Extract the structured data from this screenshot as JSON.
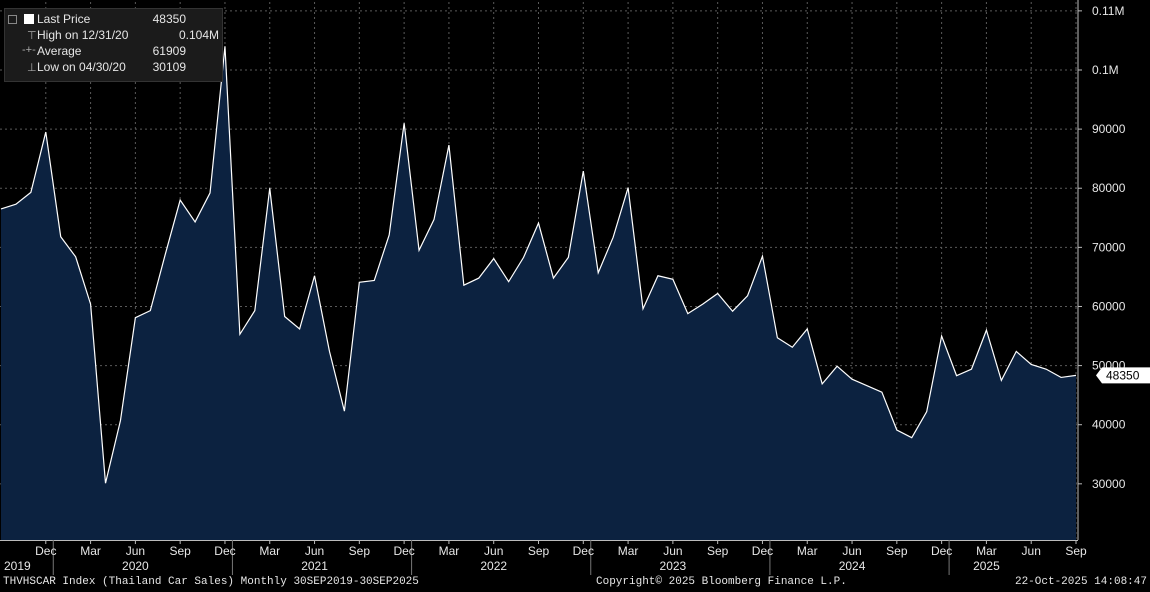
{
  "legend": {
    "last_price_label": "Last Price",
    "last_price_value": "48350",
    "high_label": "High on 12/31/20",
    "high_value": "0.104M",
    "average_label": "Average",
    "average_value": "61909",
    "low_label": "Low on 04/30/20",
    "low_value": "30109"
  },
  "footer": {
    "left": "THVHSCAR Index (Thailand Car Sales) Monthly 30SEP2019-30SEP2025",
    "center": "Copyright© 2025 Bloomberg Finance L.P.",
    "right": "22-Oct-2025 14:08:47"
  },
  "colors": {
    "background": "#000000",
    "area_fill": "#0c2240",
    "line": "#ffffff",
    "grid": "#5a5a5a",
    "text": "#e6e6e6"
  },
  "chart_data": {
    "type": "area",
    "title": "THVHSCAR Index (Thailand Car Sales)",
    "x_start": "2019-09",
    "x_end": "2025-09",
    "x_freq": "monthly",
    "y_ticks": [
      {
        "value": 30000,
        "label": "30000"
      },
      {
        "value": 40000,
        "label": "40000"
      },
      {
        "value": 50000,
        "label": "50000"
      },
      {
        "value": 60000,
        "label": "60000"
      },
      {
        "value": 70000,
        "label": "70000"
      },
      {
        "value": 80000,
        "label": "80000"
      },
      {
        "value": 90000,
        "label": "90000"
      },
      {
        "value": 100000,
        "label": "0.1M"
      },
      {
        "value": 110000,
        "label": "0.11M"
      }
    ],
    "ylim": [
      20500,
      111500
    ],
    "last_value_label": "48350",
    "x_month_ticks": [
      {
        "date": "2019-12",
        "label": "Dec"
      },
      {
        "date": "2020-03",
        "label": "Mar"
      },
      {
        "date": "2020-06",
        "label": "Jun"
      },
      {
        "date": "2020-09",
        "label": "Sep"
      },
      {
        "date": "2020-12",
        "label": "Dec"
      },
      {
        "date": "2021-03",
        "label": "Mar"
      },
      {
        "date": "2021-06",
        "label": "Jun"
      },
      {
        "date": "2021-09",
        "label": "Sep"
      },
      {
        "date": "2021-12",
        "label": "Dec"
      },
      {
        "date": "2022-03",
        "label": "Mar"
      },
      {
        "date": "2022-06",
        "label": "Jun"
      },
      {
        "date": "2022-09",
        "label": "Sep"
      },
      {
        "date": "2022-12",
        "label": "Dec"
      },
      {
        "date": "2023-03",
        "label": "Mar"
      },
      {
        "date": "2023-06",
        "label": "Jun"
      },
      {
        "date": "2023-09",
        "label": "Sep"
      },
      {
        "date": "2023-12",
        "label": "Dec"
      },
      {
        "date": "2024-03",
        "label": "Mar"
      },
      {
        "date": "2024-06",
        "label": "Jun"
      },
      {
        "date": "2024-09",
        "label": "Sep"
      },
      {
        "date": "2024-12",
        "label": "Dec"
      },
      {
        "date": "2025-03",
        "label": "Mar"
      },
      {
        "date": "2025-06",
        "label": "Jun"
      },
      {
        "date": "2025-09",
        "label": "Sep"
      }
    ],
    "x_year_ticks": [
      {
        "date": "2019-09",
        "label": "2019",
        "align": "left"
      },
      {
        "date": "2020-06",
        "label": "2020",
        "align": "center"
      },
      {
        "date": "2021-06",
        "label": "2021",
        "align": "center"
      },
      {
        "date": "2022-06",
        "label": "2022",
        "align": "center"
      },
      {
        "date": "2023-06",
        "label": "2023",
        "align": "center"
      },
      {
        "date": "2024-06",
        "label": "2024",
        "align": "center"
      },
      {
        "date": "2025-03",
        "label": "2025",
        "align": "center"
      }
    ],
    "grid": true,
    "series": [
      {
        "values": [
          76500,
          77300,
          79300,
          89500,
          71800,
          68400,
          60400,
          30109,
          40700,
          58100,
          59300,
          68800,
          78000,
          74300,
          79200,
          104000,
          55300,
          59300,
          80000,
          58300,
          56200,
          65200,
          52400,
          42300,
          64100,
          64400,
          72100,
          91000,
          69500,
          74700,
          87300,
          63600,
          64800,
          68100,
          64200,
          68300,
          74100,
          64800,
          68300,
          82900,
          65700,
          71700,
          80100,
          59600,
          65200,
          64600,
          58800,
          60400,
          62200,
          59200,
          61800,
          68500,
          54700,
          53100,
          56200,
          46900,
          49900,
          47700,
          46600,
          45500,
          39100,
          37800,
          42200,
          55000,
          48300,
          49400,
          56000,
          47500,
          52400,
          50200,
          49400,
          48000,
          48350
        ]
      }
    ]
  }
}
